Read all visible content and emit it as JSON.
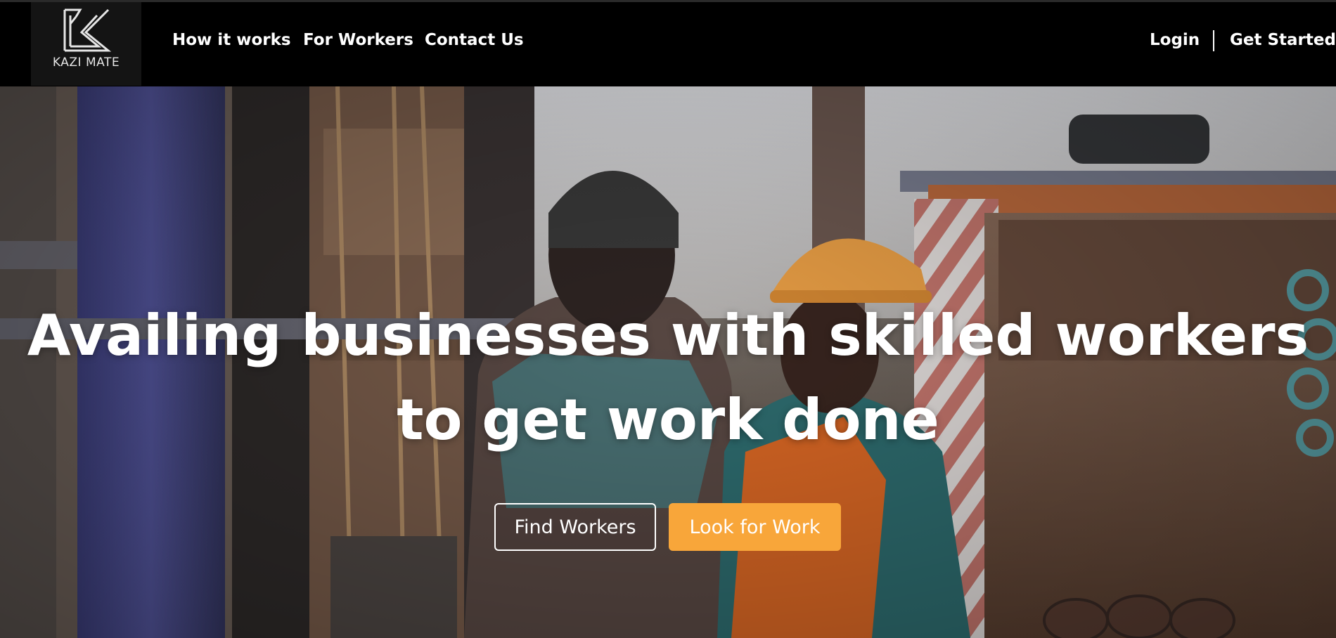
{
  "brand": {
    "logo_text": "KAZI MATE",
    "logo_icon": "k-monogram-icon"
  },
  "nav": {
    "links": [
      {
        "label": "How it works"
      },
      {
        "label": "For Workers"
      },
      {
        "label": "Contact Us"
      }
    ],
    "login": "Login",
    "get_started": "Get Started"
  },
  "hero": {
    "headline_line1": "Availing businesses with skilled workers",
    "headline_line2": "to get work done",
    "primary_cta": "Find Workers",
    "secondary_cta": "Look for Work"
  },
  "colors": {
    "navbar_bg": "#000000",
    "accent_orange": "#f8a63a",
    "text": "#ffffff"
  }
}
